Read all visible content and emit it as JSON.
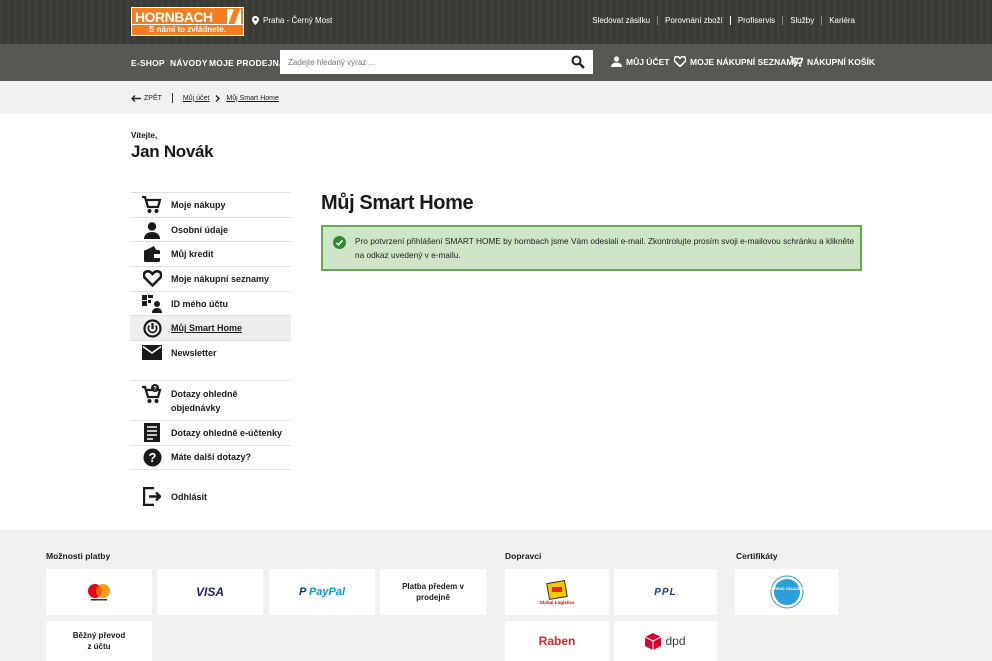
{
  "header": {
    "logo_text": "HORNBACH",
    "logo_slogan": "S námi to zvládnete.",
    "store": "Praha - Černý Most",
    "links": [
      "Sledovat zásilku",
      "Porovnání zboží",
      "Profiservis",
      "Služby",
      "Kariéra"
    ]
  },
  "nav": {
    "items": [
      "E-SHOP",
      "NÁVODY",
      "MOJE PRODEJNA"
    ],
    "search_placeholder": "Zadejte hledaný výraz ...",
    "account": "MŮJ ÚČET",
    "lists": "MOJE NÁKUPNÍ SEZNAMY",
    "cart": "NÁKUPNÍ KOŠÍK"
  },
  "breadcrumb": {
    "back": "ZPĚT",
    "items": [
      "Můj účet",
      "Můj Smart Home"
    ]
  },
  "welcome": {
    "greeting": "Vítejte,",
    "name": "Jan Novák"
  },
  "sidebar": {
    "items": [
      {
        "label": "Moje nákupy",
        "icon": "cart-icon"
      },
      {
        "label": "Osobní údaje",
        "icon": "user-icon"
      },
      {
        "label": "Můj kredit",
        "icon": "wallet-icon"
      },
      {
        "label": "Moje nákupní seznamy",
        "icon": "heart-icon"
      },
      {
        "label": "ID mého účtu",
        "icon": "id-card-icon"
      },
      {
        "label": "Můj Smart Home",
        "icon": "power-icon"
      },
      {
        "label": "Newsletter",
        "icon": "envelope-icon"
      }
    ],
    "help_items": [
      {
        "label": "Dotazy ohledně objednávky",
        "icon": "cart-question-icon"
      },
      {
        "label": "Dotazy ohledně e-účtenky",
        "icon": "receipt-icon"
      },
      {
        "label": "Máte další dotazy?",
        "icon": "question-icon"
      }
    ],
    "logout": "Odhlásit"
  },
  "main": {
    "title": "Můj Smart Home",
    "notice": "Pro potvrzení přihlášení SMART HOME by hornbach jsme Vám odeslali e-mail. Zkontrolujte prosím svoji e-mailovou schránku a klikněte na odkaz uvedený v e-mailu."
  },
  "footer": {
    "payment_heading": "Možnosti platby",
    "carriers_heading": "Dopravci",
    "certificates_heading": "Certifikáty",
    "payments": [
      "VISA",
      "PayPal",
      "Platba předem v prodejně",
      "Běžný převod z účtu"
    ],
    "carriers": [
      "Global Logistics",
      "PPL",
      "Raben",
      "dpd"
    ],
    "certificate": "OVĚŘENO ZÁKAZNÍKY"
  },
  "colors": {
    "brand_orange": "#f47d20",
    "top_bar": "#3b3b38",
    "nav_bar": "#575753",
    "notice_bg": "#cfe5c7",
    "notice_border": "#6aa84f"
  }
}
